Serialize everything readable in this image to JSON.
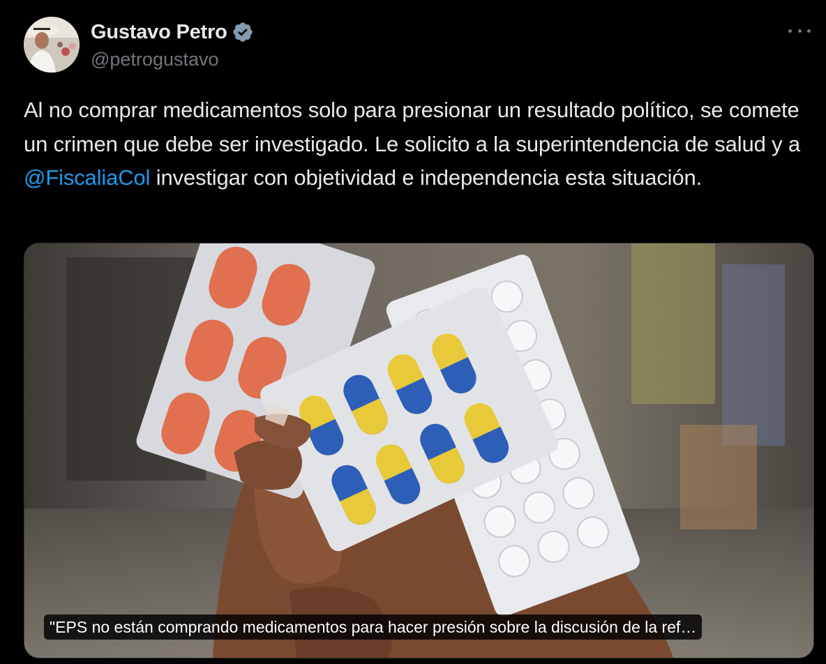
{
  "tweet": {
    "author": {
      "display_name": "Gustavo Petro",
      "handle": "@petrogustavo",
      "verified": true
    },
    "text_before_mention": "Al no comprar medicamentos solo para presionar un resultado político, se comete un crimen que debe ser investigado. Le solicito a la superintendencia de salud y a ",
    "mention": "@FiscaliaCol",
    "text_after_mention": " investigar con objetividad e independencia esta situación.",
    "media": {
      "caption": "\"EPS no están comprando medicamentos para hacer presión sobre la discusión de la ref…"
    }
  },
  "colors": {
    "background": "#000000",
    "text": "#e7e9ea",
    "secondary": "#71767b",
    "accent": "#1d9bf0"
  },
  "icons": {
    "verified": "verified-badge-icon",
    "more": "more-options-icon"
  }
}
